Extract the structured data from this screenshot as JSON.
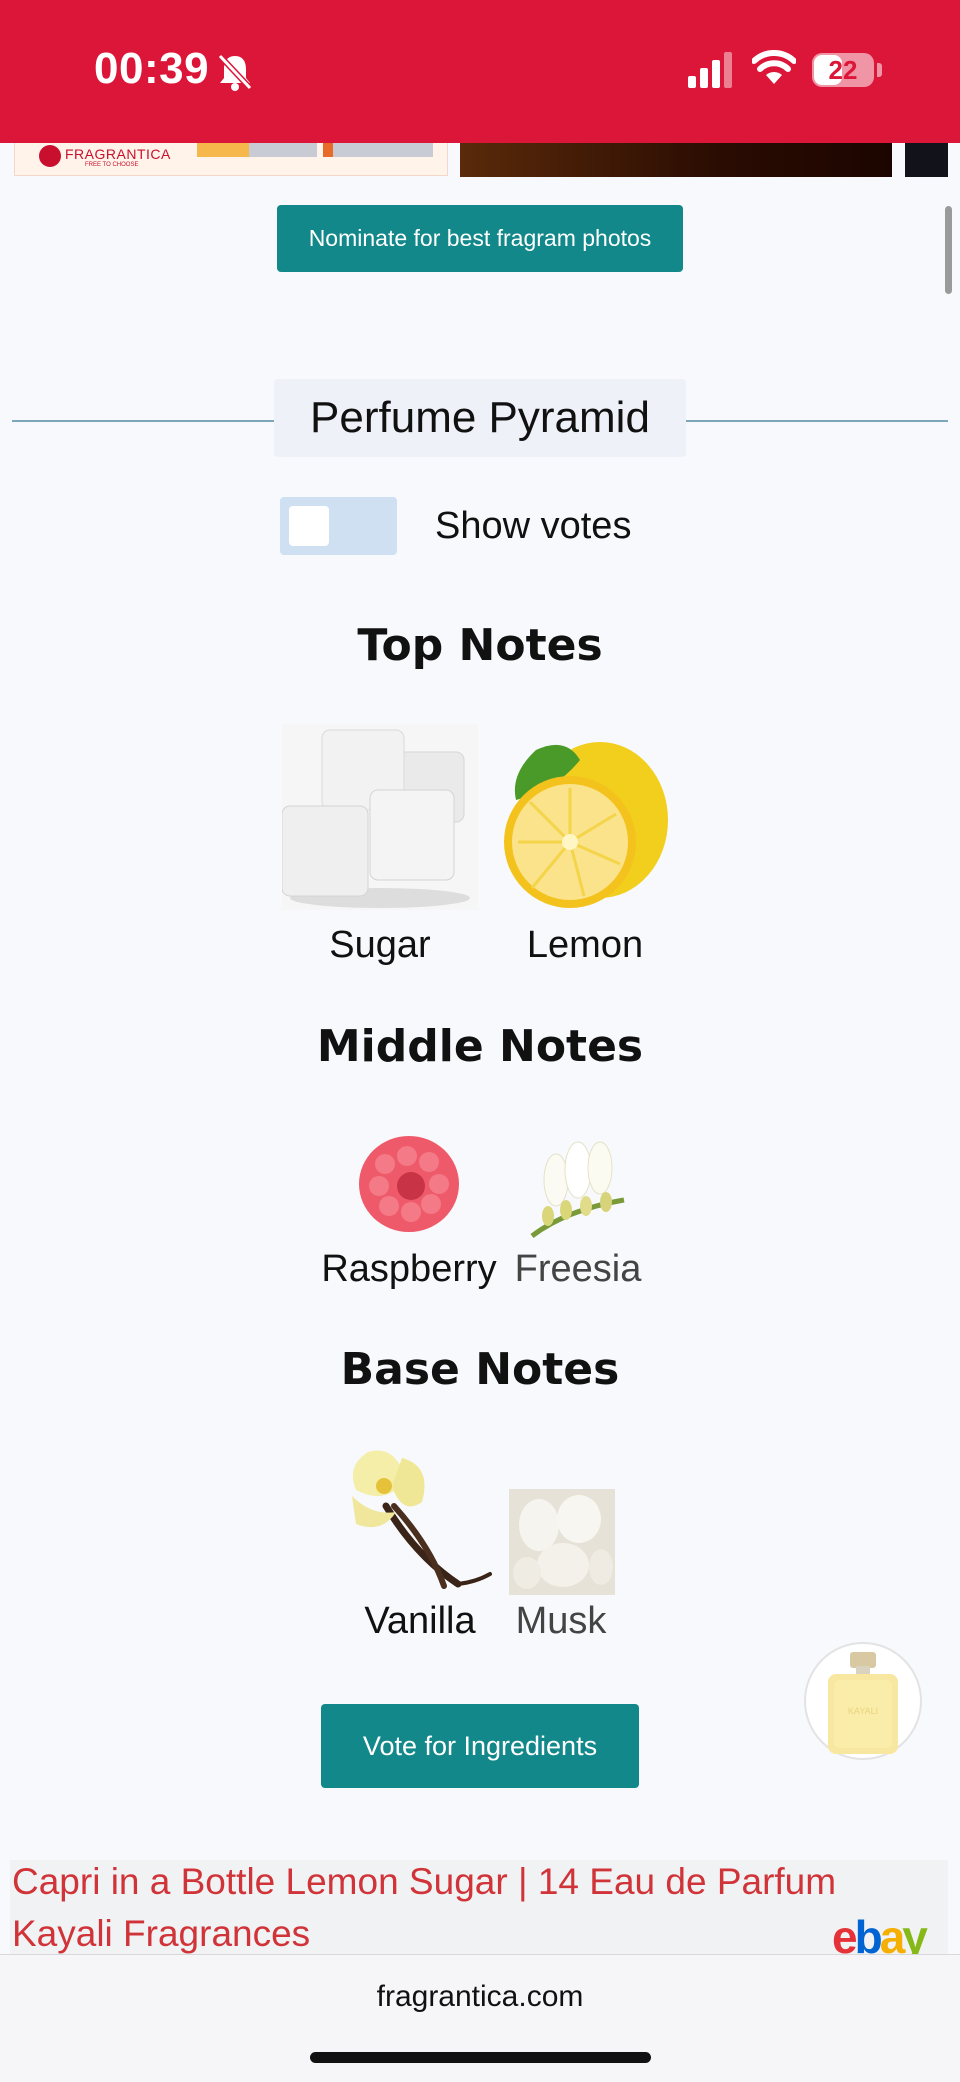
{
  "status_bar": {
    "time": "00:39",
    "battery": "22",
    "icons": [
      "bell-slash-icon",
      "signal-icon",
      "wifi-icon",
      "battery-icon"
    ]
  },
  "top_strip": {
    "brand": "FRAGRANTICA",
    "tagline": "FREE TO CHOOSE"
  },
  "nominate_button": "Nominate for best fragram photos",
  "pyramid": {
    "title": "Perfume Pyramid",
    "show_votes_label": "Show votes",
    "show_votes_checked": false
  },
  "top_notes": {
    "title": "Top Notes",
    "items": [
      {
        "label": "Sugar"
      },
      {
        "label": "Lemon"
      }
    ]
  },
  "middle_notes": {
    "title": "Middle Notes",
    "items": [
      {
        "label": "Raspberry"
      },
      {
        "label": "Freesia"
      }
    ]
  },
  "base_notes": {
    "title": "Base Notes",
    "items": [
      {
        "label": "Vanilla"
      },
      {
        "label": "Musk"
      }
    ]
  },
  "vote_button": "Vote for Ingredients",
  "bottle_label": "KAYALI",
  "ad": {
    "text": "Capri in a Bottle Lemon Sugar | 14 Eau de Parfum Kayali Fragrances",
    "logo": [
      "e",
      "b",
      "a",
      "y"
    ],
    "logo_colors": [
      "#e53238",
      "#0064d2",
      "#f5af02",
      "#86b817"
    ]
  },
  "browser": {
    "url": "fragrantica.com"
  },
  "colors": {
    "status_bar": "#dc1638",
    "button": "#12888a",
    "ad_text": "#d03438"
  }
}
